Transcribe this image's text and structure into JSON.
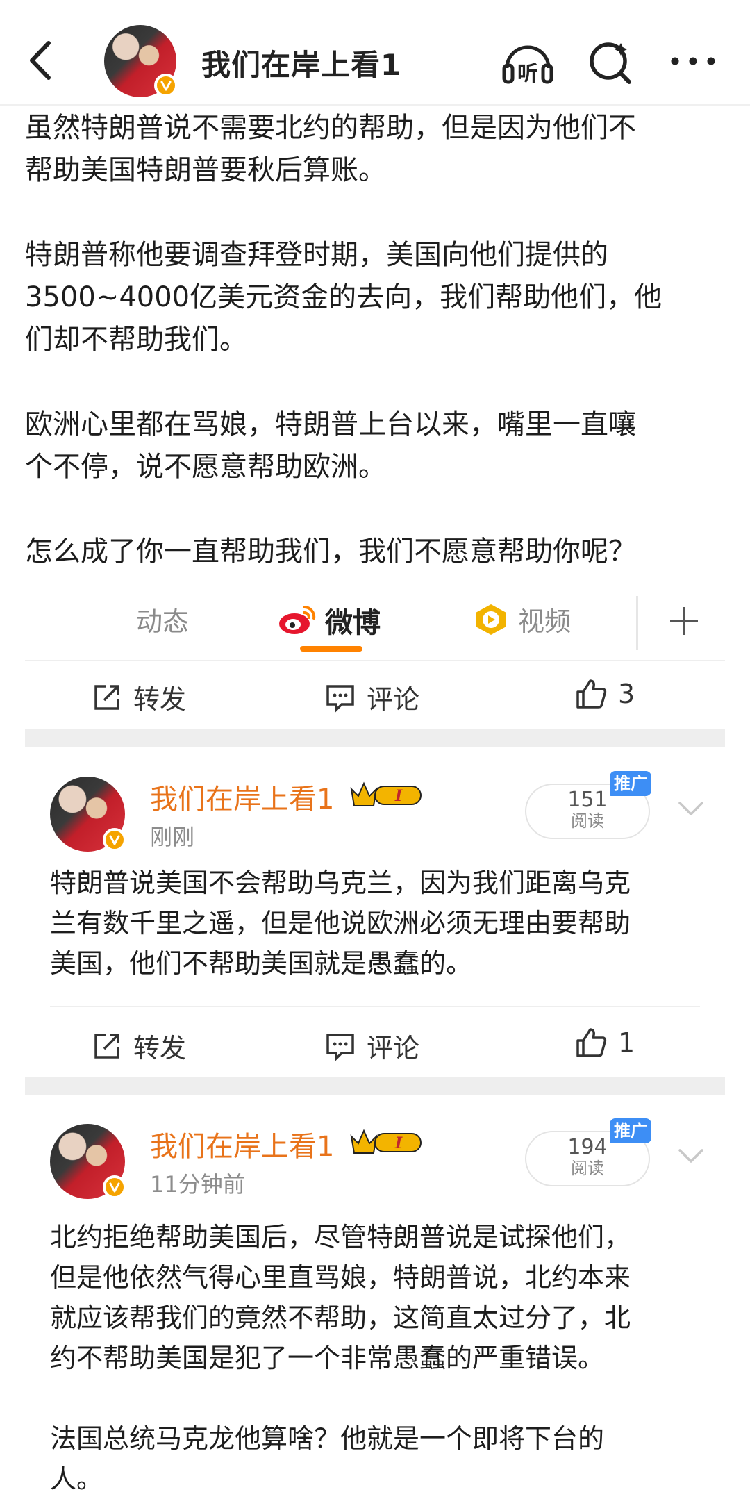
{
  "header": {
    "title": "我们在岸上看1",
    "icons": [
      "back-arrow-icon",
      "listen-icon",
      "search-icon",
      "more-icon"
    ],
    "listen_label": "听"
  },
  "post": {
    "paragraphs": [
      [
        "虽然特朗普说不需要北约的帮助，但是因为他们不",
        "帮助美国特朗普要秋后算账。"
      ],
      [
        "特朗普称他要调查拜登时期，美国向他们提供的",
        "3500~4000亿美元资金的去向，我们帮助他们，他",
        "们却不帮助我们。"
      ],
      [
        "欧洲心里都在骂娘，特朗普上台以来，嘴里一直嚷",
        "个不停，说不愿意帮助欧洲。"
      ],
      [
        "怎么成了你一直帮助我们，我们不愿意帮助你呢？"
      ]
    ]
  },
  "tabs": {
    "dynamic": "动态",
    "weibo": "微博",
    "video": "视频",
    "active": "微博",
    "accent": "#ff8200"
  },
  "actions": {
    "repost": "转发",
    "comment": "评论"
  },
  "top_actions": {
    "likes": "3"
  },
  "feed": [
    {
      "name": "我们在岸上看1",
      "time": "刚刚",
      "reads": "151",
      "read_label": "阅读",
      "promo": "推广",
      "level_badge": "I",
      "paragraphs": [
        [
          "特朗普说美国不会帮助乌克兰，因为我们距离乌克",
          "兰有数千里之遥，但是他说欧洲必须无理由要帮助",
          "美国，他们不帮助美国就是愚蠢的。"
        ]
      ],
      "likes": "1"
    },
    {
      "name": "我们在岸上看1",
      "time": "11分钟前",
      "reads": "194",
      "read_label": "阅读",
      "promo": "推广",
      "level_badge": "I",
      "paragraphs": [
        [
          "北约拒绝帮助美国后，尽管特朗普说是试探他们，",
          "但是他依然气得心里直骂娘，特朗普说，北约本来",
          "就应该帮我们的竟然不帮助，这简直太过分了，北",
          "约不帮助美国是犯了一个非常愚蠢的严重错误。"
        ],
        [
          "法国总统马克龙他算啥？他就是一个即将下台的",
          "人。"
        ]
      ]
    }
  ],
  "colors": {
    "name": "#e8731a",
    "badge": "#f5a300",
    "promo": "#3d8ef5"
  }
}
